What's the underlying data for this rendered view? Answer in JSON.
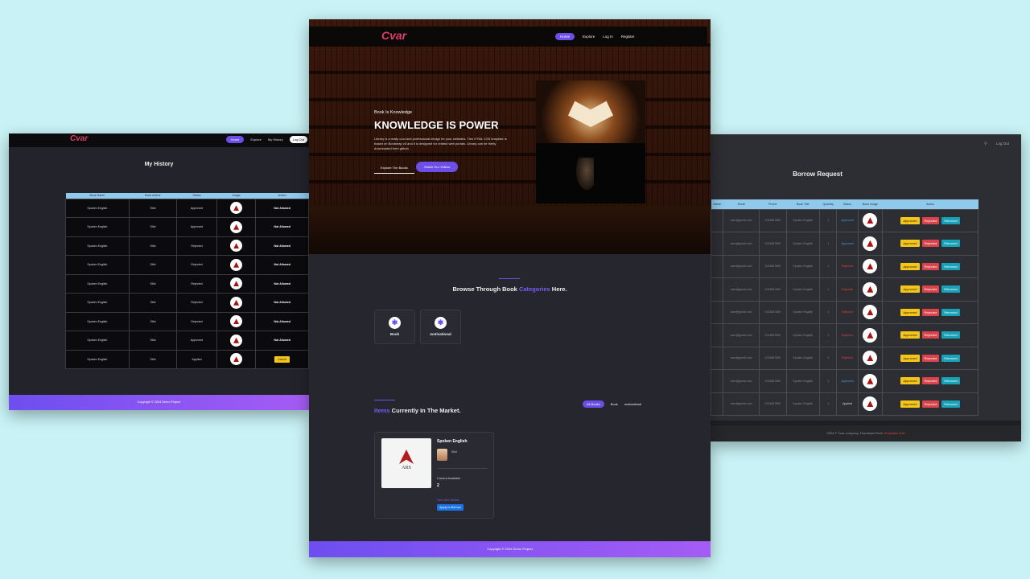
{
  "left": {
    "logo": "Cvar",
    "nav": [
      "Home",
      "Explore",
      "My History",
      "Log Out"
    ],
    "title": "My History",
    "columns": [
      "Book Name",
      "Book Author",
      "Status",
      "Image",
      "Action"
    ],
    "rows": [
      {
        "name": "Spoken English",
        "author": "Siful",
        "status": "Approved",
        "action": "Not Allowed"
      },
      {
        "name": "Spoken English",
        "author": "Siful",
        "status": "Approved",
        "action": "Not Allowed"
      },
      {
        "name": "Spoken English",
        "author": "Siful",
        "status": "Rejected",
        "action": "Not Allowed"
      },
      {
        "name": "Spoken English",
        "author": "Siful",
        "status": "Rejected",
        "action": "Not Allowed"
      },
      {
        "name": "Spoken English",
        "author": "Siful",
        "status": "Rejected",
        "action": "Not Allowed"
      },
      {
        "name": "Spoken English",
        "author": "Siful",
        "status": "Rejected",
        "action": "Not Allowed"
      },
      {
        "name": "Spoken English",
        "author": "Siful",
        "status": "Rejected",
        "action": "Not Allowed"
      },
      {
        "name": "Spoken English",
        "author": "Siful",
        "status": "Approved",
        "action": "Not Allowed"
      },
      {
        "name": "Spoken English",
        "author": "Siful",
        "status": "Applied",
        "action": "Cancel"
      }
    ],
    "footer": "Copyright © 2024 Demo Project"
  },
  "center": {
    "logo": "Cvar",
    "nav": [
      "Home",
      "Explore",
      "Log In",
      "Register"
    ],
    "kicker": "Book Is Knowledge",
    "headline": "KNOWLEDGE IS POWER",
    "desc": "Library is a really cool and professional design for your websites. This HTML CSS template is based on Bootstrap v5 and it is designed for related web portals. Library can be freely downloaded from github.",
    "btn_explore": "Explore The Books",
    "btn_watch": "Watch Our Videos",
    "browse_prefix": "Browse Through Book ",
    "browse_highlight": "Categories",
    "browse_suffix": " Here.",
    "categories": [
      "Book",
      "motivational"
    ],
    "items_highlight": "Items",
    "items_suffix": " Currently In The Market.",
    "filters": [
      "All Books",
      "Book",
      "motivational"
    ],
    "card": {
      "title": "Spoken English",
      "author": "Siful",
      "available_label": "Current Available",
      "available": "2",
      "view": "View Item Details",
      "apply": "Apply to Borrow",
      "cover_text": "ARS"
    },
    "footer": "Copyright © 2024 Demo Project"
  },
  "right": {
    "search_icon": "search-icon",
    "logout": "Log Out",
    "title": "Borrow Request",
    "columns": [
      "Name",
      "Email",
      "Phone",
      "Book Title",
      "Quantity",
      "Status",
      "Book Image",
      "Action"
    ],
    "rows": [
      {
        "email": "user@gmail.com",
        "phone": "1234567890",
        "title": "Spoken English",
        "qty": "1",
        "status": "Approved"
      },
      {
        "email": "user@gmail.com",
        "phone": "1234567890",
        "title": "Spoken English",
        "qty": "1",
        "status": "Approved"
      },
      {
        "email": "user@gmail.com",
        "phone": "1234567890",
        "title": "Spoken English",
        "qty": "1",
        "status": "Rejected"
      },
      {
        "email": "user@gmail.com",
        "phone": "1234567890",
        "title": "Spoken English",
        "qty": "1",
        "status": "Rejected"
      },
      {
        "email": "user@gmail.com",
        "phone": "1234567890",
        "title": "Spoken English",
        "qty": "1",
        "status": "Rejected"
      },
      {
        "email": "user@gmail.com",
        "phone": "1234567890",
        "title": "Spoken English",
        "qty": "1",
        "status": "Rejected"
      },
      {
        "email": "user@gmail.com",
        "phone": "1234567890",
        "title": "Spoken English",
        "qty": "1",
        "status": "Rejected"
      },
      {
        "email": "user@gmail.com",
        "phone": "1234567890",
        "title": "Spoken English",
        "qty": "1",
        "status": "Approved"
      },
      {
        "email": "user@gmail.com",
        "phone": "1234567890",
        "title": "Spoken English",
        "qty": "1",
        "status": "Applied"
      }
    ],
    "actions": [
      "Approved",
      "Rejected",
      "Returned"
    ],
    "footer_prefix": "2024 © Your company. Download From ",
    "footer_link": "Templates Hub"
  }
}
